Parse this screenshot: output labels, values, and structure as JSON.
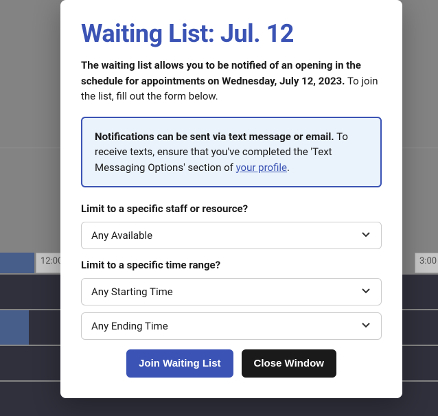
{
  "modal": {
    "title": "Waiting List: Jul. 12",
    "intro_bold": "The waiting list allows you to be notified of an opening in the schedule for appointments on Wednesday, July 12, 2023.",
    "intro_rest": " To join the list, fill out the form below.",
    "infobox_bold": "Notifications can be sent via text message or email.",
    "infobox_rest": " To receive texts, ensure that you've completed the 'Text Messaging Options' section of ",
    "profile_link_text": "your profile",
    "infobox_period": ".",
    "staff_label": "Limit to a specific staff or resource?",
    "staff_value": "Any Available",
    "time_label": "Limit to a specific time range?",
    "start_value": "Any Starting Time",
    "end_value": "Any Ending Time",
    "join_button": "Join Waiting List",
    "close_button": "Close Window"
  },
  "background": {
    "time_1200": "12:00",
    "time_300": "3:00"
  },
  "colors": {
    "accent": "#3a53b4",
    "infobox_bg": "#eaf2fb"
  }
}
